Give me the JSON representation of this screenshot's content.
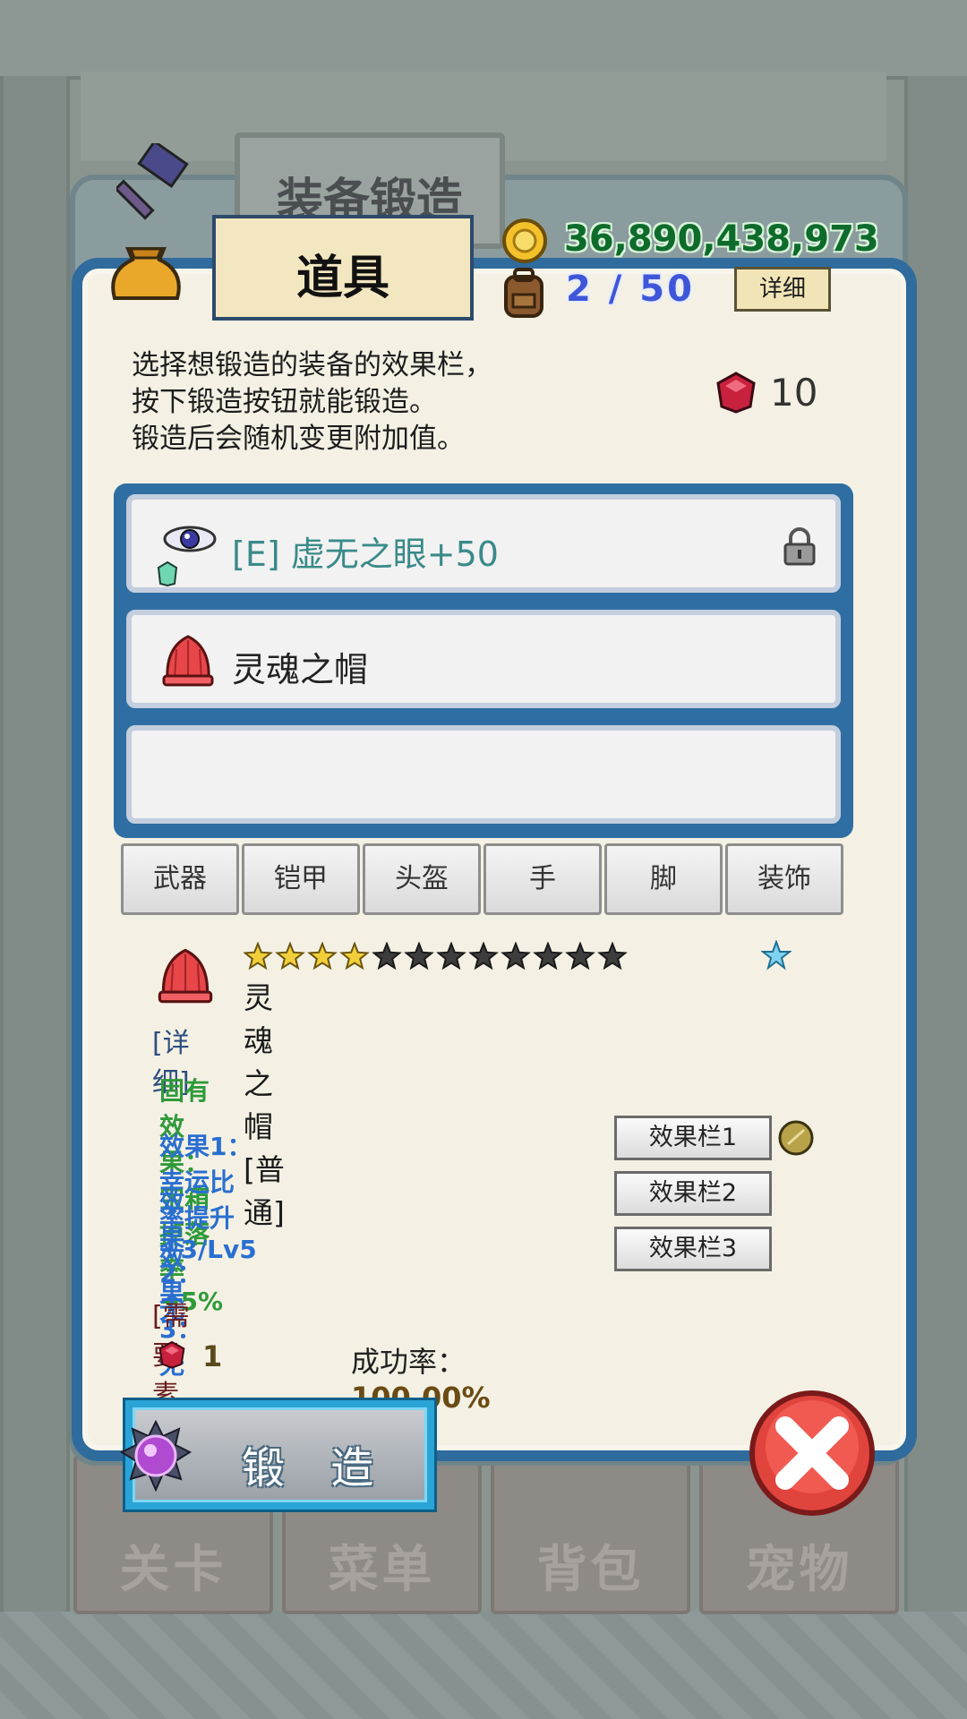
{
  "background": {
    "bottom_tabs": [
      "关卡",
      "菜单",
      "背包",
      "宠物"
    ]
  },
  "header": {
    "title": "装备锻造",
    "tab_label": "道具",
    "gold": "36,890,438,973",
    "bag_count": "2 / 50",
    "detail_button": "详细"
  },
  "instructions": {
    "line1": "选择想锻造的装备的效果栏，",
    "line2": "按下锻造按钮就能锻造。",
    "line3": "锻造后会随机变更附加值。"
  },
  "gem_count": "10",
  "slots": [
    {
      "label": "[E] 虚无之眼+50",
      "icon": "eye-icon",
      "locked": true,
      "color": "#3a8a8a"
    },
    {
      "label": "灵魂之帽",
      "icon": "red-hat-icon",
      "locked": false,
      "color": "#222222"
    },
    {
      "label": "",
      "icon": "",
      "locked": false
    }
  ],
  "categories": [
    "武器",
    "铠甲",
    "头盔",
    "手",
    "脚",
    "装饰"
  ],
  "selected_item": {
    "stars_filled": 4,
    "stars_total": 12,
    "name": "灵魂之帽 [普通]",
    "detail_header": "[详细]",
    "fixed_effect": "固有效果：宝箱掉落率+5%",
    "effect1": "效果1：幸运比率提升+3/Lv5",
    "effect2": "效果2：无",
    "effect3": "效果3：无",
    "effect_buttons": [
      "效果栏1",
      "效果栏2",
      "效果栏3"
    ]
  },
  "materials": {
    "header": "[需要素材]",
    "gem_required": "1",
    "success_label": "成功率：",
    "success_value": "100.00%"
  },
  "forge_button": "锻 造",
  "colors": {
    "panel_border": "#2f6b9c",
    "fixed_effect": "#2f9a3a",
    "effect": "#2a6fd0",
    "gold_text": "#0e6b2c",
    "bag_text": "#3f56d8"
  }
}
